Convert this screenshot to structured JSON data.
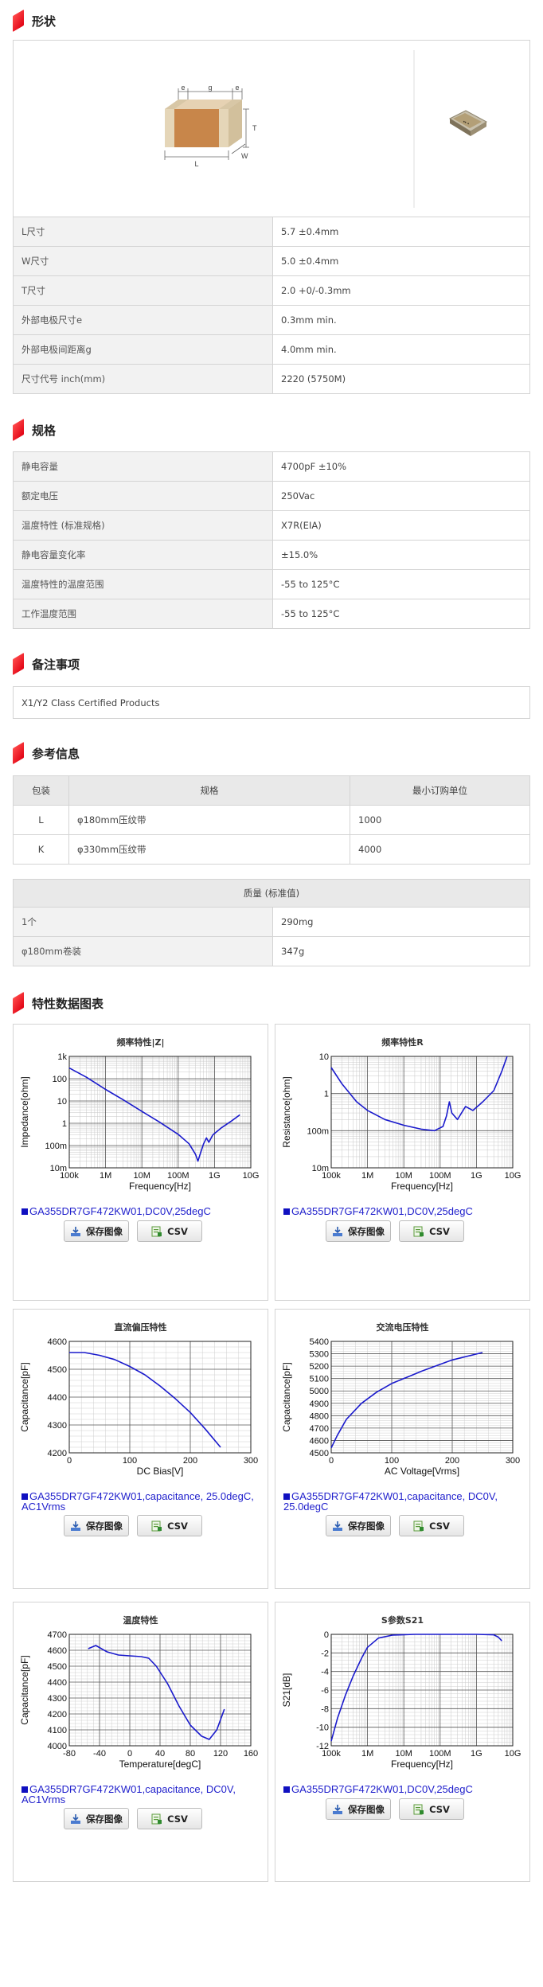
{
  "shape": {
    "title": "形状",
    "dim_labels": {
      "e1": "e",
      "g": "g",
      "e2": "e",
      "T": "T",
      "L": "L",
      "W": "W"
    },
    "rows": [
      {
        "k": "L尺寸",
        "v": "5.7 ±0.4mm"
      },
      {
        "k": "W尺寸",
        "v": "5.0 ±0.4mm"
      },
      {
        "k": "T尺寸",
        "v": "2.0 +0/-0.3mm"
      },
      {
        "k": "外部电极尺寸e",
        "v": "0.3mm min."
      },
      {
        "k": "外部电极间距离g",
        "v": "4.0mm min."
      },
      {
        "k": "尺寸代号 inch(mm)",
        "v": "2220 (5750M)"
      }
    ]
  },
  "spec": {
    "title": "规格",
    "rows": [
      {
        "k": "静电容量",
        "v": "4700pF ±10%"
      },
      {
        "k": "额定电压",
        "v": "250Vac"
      },
      {
        "k": "温度特性 (标准规格)",
        "v": "X7R(EIA)"
      },
      {
        "k": "静电容量变化率",
        "v": "±15.0%"
      },
      {
        "k": "温度特性的温度范围",
        "v": "-55 to 125°C"
      },
      {
        "k": "工作温度范围",
        "v": "-55 to 125°C"
      }
    ]
  },
  "notes": {
    "title": "备注事项",
    "text": "X1/Y2 Class Certified Products"
  },
  "ref": {
    "title": "参考信息",
    "pkg_headers": [
      "包装",
      "规格",
      "最小订购单位"
    ],
    "pkg_rows": [
      [
        "L",
        "φ180mm压纹带",
        "1000"
      ],
      [
        "K",
        "φ330mm压纹带",
        "4000"
      ]
    ],
    "mass_header": "质量 (标准值)",
    "mass_rows": [
      {
        "k": "1个",
        "v": "290mg"
      },
      {
        "k": "φ180mm卷装",
        "v": "347g"
      }
    ]
  },
  "charts_section_title": "特性数据图表",
  "buttons": {
    "save": "保存图像",
    "csv": "CSV"
  },
  "charts": [
    {
      "id": "c1",
      "title": "频率特性|Z|",
      "ylabel": "Impedance[ohm]",
      "xlabel": "Frequency[Hz]",
      "xlog": true,
      "ylog": true,
      "xlim": [
        100000,
        10000000000
      ],
      "ylim": [
        0.01,
        1000
      ],
      "xticks": [
        "100k",
        "1M",
        "10M",
        "100M",
        "1G",
        "10G"
      ],
      "yticks": [
        "10m",
        "100m",
        "1",
        "10",
        "100",
        "1k"
      ],
      "legend": "GA355DR7GF472KW01,DC0V,25degC",
      "series": [
        {
          "points": [
            [
              100000,
              300
            ],
            [
              300000,
              115
            ],
            [
              1000000,
              33
            ],
            [
              3000000,
              11.5
            ],
            [
              10000000,
              3.4
            ],
            [
              30000000,
              1.15
            ],
            [
              100000000,
              0.32
            ],
            [
              200000000,
              0.12
            ],
            [
              300000000,
              0.04
            ],
            [
              350000000,
              0.02
            ],
            [
              400000000,
              0.04
            ],
            [
              500000000,
              0.12
            ],
            [
              600000000,
              0.22
            ],
            [
              700000000,
              0.14
            ],
            [
              900000000,
              0.3
            ],
            [
              1500000000,
              0.6
            ],
            [
              3000000000,
              1.3
            ],
            [
              5000000000,
              2.4
            ]
          ]
        }
      ]
    },
    {
      "id": "c2",
      "title": "频率特性R",
      "ylabel": "Resistance[ohm]",
      "xlabel": "Frequency[Hz]",
      "xlog": true,
      "ylog": true,
      "xlim": [
        100000,
        10000000000
      ],
      "ylim": [
        0.01,
        10
      ],
      "xticks": [
        "100k",
        "1M",
        "10M",
        "100M",
        "1G",
        "10G"
      ],
      "yticks": [
        "10m",
        "100m",
        "1",
        "10"
      ],
      "legend": "GA355DR7GF472KW01,DC0V,25degC",
      "series": [
        {
          "points": [
            [
              100000,
              5
            ],
            [
              200000,
              1.8
            ],
            [
              500000,
              0.6
            ],
            [
              1000000,
              0.35
            ],
            [
              3000000,
              0.2
            ],
            [
              10000000,
              0.14
            ],
            [
              30000000,
              0.11
            ],
            [
              70000000,
              0.1
            ],
            [
              120000000,
              0.13
            ],
            [
              150000000,
              0.25
            ],
            [
              180000000,
              0.6
            ],
            [
              210000000,
              0.3
            ],
            [
              300000000,
              0.2
            ],
            [
              500000000,
              0.45
            ],
            [
              800000000,
              0.35
            ],
            [
              1500000000,
              0.6
            ],
            [
              3000000000,
              1.2
            ],
            [
              5000000000,
              4
            ],
            [
              7000000000,
              10
            ]
          ]
        }
      ]
    },
    {
      "id": "c3",
      "title": "直流偏压特性",
      "ylabel": "Capacitance[pF]",
      "xlabel": "DC Bias[V]",
      "xlog": false,
      "ylog": false,
      "xlim": [
        0,
        300
      ],
      "ylim": [
        4200,
        4600
      ],
      "xticks": [
        "0",
        "100",
        "200",
        "300"
      ],
      "yticks": [
        "4200",
        "4300",
        "4400",
        "4500",
        "4600"
      ],
      "legend": "GA355DR7GF472KW01,capacitance, 25.0degC, AC1Vrms",
      "series": [
        {
          "points": [
            [
              0,
              4560
            ],
            [
              25,
              4560
            ],
            [
              50,
              4550
            ],
            [
              75,
              4535
            ],
            [
              100,
              4510
            ],
            [
              125,
              4480
            ],
            [
              150,
              4440
            ],
            [
              175,
              4395
            ],
            [
              200,
              4345
            ],
            [
              225,
              4285
            ],
            [
              250,
              4220
            ]
          ]
        }
      ]
    },
    {
      "id": "c4",
      "title": "交流电压特性",
      "ylabel": "Capacitance[pF]",
      "xlabel": "AC Voltage[Vrms]",
      "xlog": false,
      "ylog": false,
      "xlim": [
        0,
        300
      ],
      "ylim": [
        4500,
        5400
      ],
      "xticks": [
        "0",
        "100",
        "200",
        "300"
      ],
      "yticks": [
        "4500",
        "4600",
        "4700",
        "4800",
        "4900",
        "5000",
        "5100",
        "5200",
        "5300",
        "5400"
      ],
      "legend": "GA355DR7GF472KW01,capacitance, DC0V, 25.0degC",
      "series": [
        {
          "points": [
            [
              0,
              4540
            ],
            [
              10,
              4640
            ],
            [
              25,
              4770
            ],
            [
              50,
              4900
            ],
            [
              75,
              4990
            ],
            [
              100,
              5060
            ],
            [
              150,
              5160
            ],
            [
              200,
              5250
            ],
            [
              250,
              5310
            ]
          ]
        }
      ]
    },
    {
      "id": "c5",
      "title": "温度特性",
      "ylabel": "Capacitance[pF]",
      "xlabel": "Temperature[degC]",
      "xlog": false,
      "ylog": false,
      "xlim": [
        -80,
        160
      ],
      "ylim": [
        4000,
        4700
      ],
      "xticks": [
        "-80",
        "-40",
        "0",
        "40",
        "80",
        "120",
        "160"
      ],
      "yticks": [
        "4000",
        "4100",
        "4200",
        "4300",
        "4400",
        "4500",
        "4600",
        "4700"
      ],
      "legend": "GA355DR7GF472KW01,capacitance, DC0V, AC1Vrms",
      "series": [
        {
          "points": [
            [
              -55,
              4610
            ],
            [
              -45,
              4630
            ],
            [
              -30,
              4590
            ],
            [
              -15,
              4570
            ],
            [
              0,
              4565
            ],
            [
              15,
              4560
            ],
            [
              25,
              4550
            ],
            [
              35,
              4500
            ],
            [
              50,
              4390
            ],
            [
              65,
              4250
            ],
            [
              80,
              4130
            ],
            [
              95,
              4060
            ],
            [
              105,
              4040
            ],
            [
              115,
              4100
            ],
            [
              125,
              4230
            ]
          ]
        }
      ]
    },
    {
      "id": "c6",
      "title": "S参数S21",
      "ylabel": "S21[dB]",
      "xlabel": "Frequency[Hz]",
      "xlog": true,
      "ylog": false,
      "xlim": [
        100000,
        10000000000
      ],
      "ylim": [
        -12,
        0
      ],
      "xticks": [
        "100k",
        "1M",
        "10M",
        "100M",
        "1G",
        "10G"
      ],
      "yticks": [
        "-12",
        "-10",
        "-8",
        "-6",
        "-4",
        "-2",
        "0"
      ],
      "legend": "GA355DR7GF472KW01,DC0V,25degC",
      "series": [
        {
          "points": [
            [
              100000,
              -11.5
            ],
            [
              150000,
              -9
            ],
            [
              250000,
              -6.5
            ],
            [
              400000,
              -4.5
            ],
            [
              700000,
              -2.5
            ],
            [
              1000000,
              -1.4
            ],
            [
              2000000,
              -0.4
            ],
            [
              5000000,
              -0.08
            ],
            [
              20000000,
              0
            ],
            [
              100000000,
              0
            ],
            [
              1000000000,
              0
            ],
            [
              3000000000,
              -0.05
            ],
            [
              4000000000,
              -0.3
            ],
            [
              5000000000,
              -0.7
            ]
          ]
        }
      ]
    }
  ],
  "colors": {
    "accent": "#e60012",
    "header_bg": "#f2f2f2",
    "border": "#d4d4d4",
    "curve": "#1a1acc"
  }
}
